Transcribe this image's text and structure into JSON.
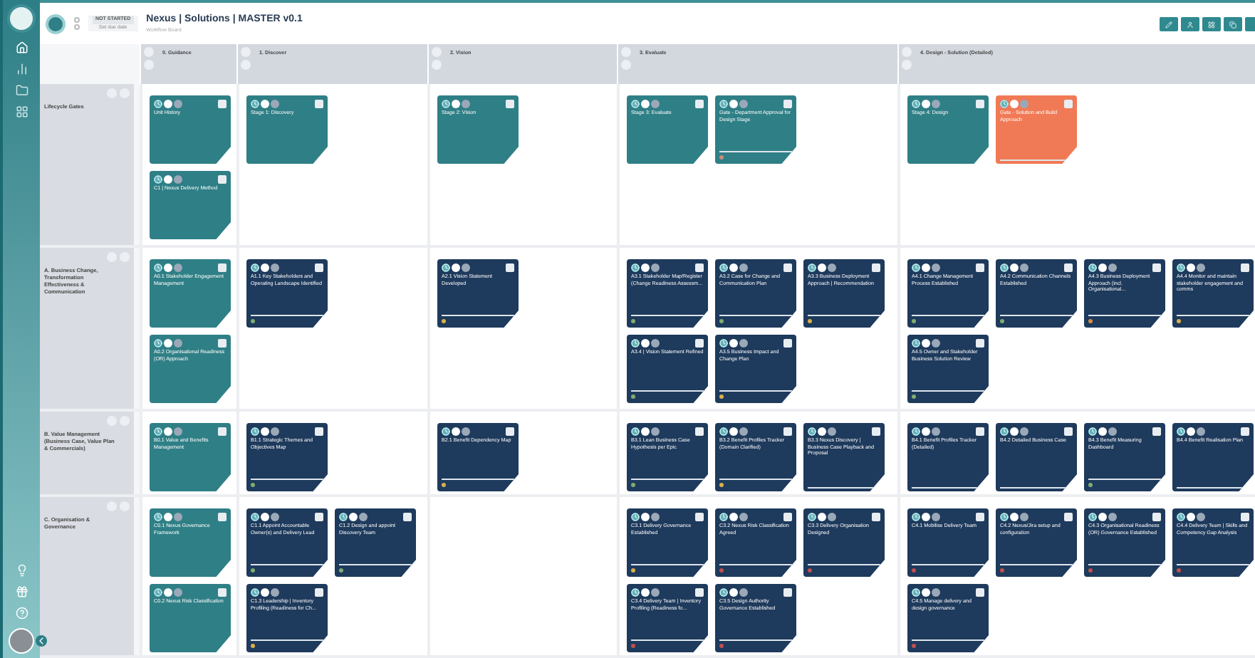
{
  "header": {
    "status": "NOT STARTED",
    "due": "Set due date",
    "title": "Nexus | Solutions | MASTER v0.1",
    "subtitle": "Workflow Board"
  },
  "columns": [
    {
      "title": "0. Guidance"
    },
    {
      "title": "1. Discover"
    },
    {
      "title": "2. Vision"
    },
    {
      "title": "3. Evaluate"
    },
    {
      "title": "4. Design - Solution (Detailed)"
    }
  ],
  "rows": [
    {
      "title": "Lifecycle Gates",
      "cells": [
        [
          {
            "name": "Unit History",
            "color": "#2f7f86",
            "bar": false
          },
          {
            "name": "C1 | Nexus Delivery Method",
            "color": "#2f7f86",
            "bar": false
          }
        ],
        [
          {
            "name": "Stage 1: Discovery",
            "color": "#2f7f86",
            "bar": false
          }
        ],
        [
          {
            "name": "Stage 2: Vision",
            "color": "#2f7f86",
            "bar": false
          }
        ],
        [
          {
            "name": "Stage 3: Evaluate",
            "color": "#2f7f86",
            "bar": false
          },
          {
            "name": "Gate - Department Approval for Design Stage",
            "color": "#2f7f86",
            "bar": true,
            "status": {
              "color": "#c98a7a"
            }
          }
        ],
        [
          {
            "name": "Stage 4: Design",
            "color": "#2f7f86",
            "bar": false
          },
          {
            "name": "Gate - Solution and Build Approach",
            "color": "#f07a55",
            "bar": true
          }
        ]
      ]
    },
    {
      "title": "A. Business Change, Transformation Effectiveness & Communication",
      "cells": [
        [
          {
            "name": "A0.1 Stakeholder Engagement Management",
            "color": "#2f7f86",
            "bar": false
          },
          {
            "name": "A0.2 Organisational Readiness (OR) Approach",
            "color": "#2f7f86",
            "bar": false
          }
        ],
        [
          {
            "name": "A1.1 Key Stakeholders and Operating Landscape Identified",
            "color": "#1e3a5c",
            "bar": true,
            "status": {
              "color": "#7fae6f"
            }
          }
        ],
        [
          {
            "name": "A2.1 Vision Statement Developed",
            "color": "#1e3a5c",
            "bar": true,
            "status": {
              "color": "#d9b04a"
            }
          }
        ],
        [
          {
            "name": "A3.1 Stakeholder Map/Register (Change Readiness Assessm...",
            "color": "#1e3a5c",
            "bar": true,
            "status": {
              "color": "#7fae6f"
            }
          },
          {
            "name": "A3.2 Case for Change and Communication Plan",
            "color": "#1e3a5c",
            "bar": true,
            "status": {
              "color": "#7fae6f"
            }
          },
          {
            "name": "A3.3 Business Deployment Approach | Recommendation",
            "color": "#1e3a5c",
            "bar": true,
            "status": {
              "color": "#d9b04a"
            }
          },
          {
            "name": "A3.4 | Vision Statement Refined",
            "color": "#1e3a5c",
            "bar": true,
            "status": {
              "color": "#7fae6f"
            }
          },
          {
            "name": "A3.5 Business Impact and Change Plan",
            "color": "#1e3a5c",
            "bar": true,
            "status": {
              "color": "#d9b04a"
            }
          }
        ],
        [
          {
            "name": "A4.1 Change Management Process Established",
            "color": "#1e3a5c",
            "bar": true,
            "status": {
              "color": "#7fae6f"
            }
          },
          {
            "name": "A4.2 Communication Channels Established",
            "color": "#1e3a5c",
            "bar": true,
            "status": {
              "color": "#7fae6f"
            }
          },
          {
            "name": "A4.3 Business Deployment Approach (incl. Organisational...",
            "color": "#1e3a5c",
            "bar": true,
            "status": {
              "color": "#e08a3a"
            }
          },
          {
            "name": "A4.4 Monitor and maintain stakeholder engagement and comms",
            "color": "#1e3a5c",
            "bar": true,
            "status": {
              "color": "#d9b04a"
            }
          },
          {
            "name": "A4.5 Owner and Stakeholder Business Solution Review",
            "color": "#1e3a5c",
            "bar": true,
            "status": {
              "color": "#7fae6f"
            }
          }
        ]
      ]
    },
    {
      "title": "B. Value Management (Business Case, Value Plan & Commercials)",
      "cells": [
        [
          {
            "name": "B0.1 Value and Benefits Management",
            "color": "#2f7f86",
            "bar": false
          }
        ],
        [
          {
            "name": "B1.1 Strategic Themes and Objectives Map",
            "color": "#1e3a5c",
            "bar": true,
            "status": {
              "color": "#7fae6f"
            }
          }
        ],
        [
          {
            "name": "B2.1 Benefit Dependency Map",
            "color": "#1e3a5c",
            "bar": true,
            "status": {
              "color": "#d9b04a"
            }
          }
        ],
        [
          {
            "name": "B3.1 Lean Business Case Hypothesis per Epic",
            "color": "#1e3a5c",
            "bar": true,
            "status": {
              "color": "#7fae6f"
            }
          },
          {
            "name": "B3.2 Benefit Profiles Tracker (Domain Clarified)",
            "color": "#1e3a5c",
            "bar": true,
            "status": {
              "color": "#d9b04a"
            }
          },
          {
            "name": "B3.3 Nexus Discovery | Business Case Playback and Proposal",
            "color": "#1e3a5c",
            "bar": true
          }
        ],
        [
          {
            "name": "B4.1 Benefit Profiles Tracker (Detailed)",
            "color": "#1e3a5c",
            "bar": true
          },
          {
            "name": "B4.2 Detailed Business Case",
            "color": "#1e3a5c",
            "bar": true
          },
          {
            "name": "B4.3 Benefit Measuring Dashboard",
            "color": "#1e3a5c",
            "bar": true,
            "status": {
              "color": "#7fae6f"
            }
          },
          {
            "name": "B4.4 Benefit Realisation Plan",
            "color": "#1e3a5c",
            "bar": true
          }
        ]
      ]
    },
    {
      "title": "C. Organisation & Governance",
      "cells": [
        [
          {
            "name": "C0.1 Nexus Governance Framework",
            "color": "#2f7f86",
            "bar": false
          },
          {
            "name": "C0.2 Nexus Risk Classification",
            "color": "#2f7f86",
            "bar": false
          }
        ],
        [
          {
            "name": "C1.1 Appoint Accountable Owner(s) and Delivery Lead",
            "color": "#1e3a5c",
            "bar": true,
            "status": {
              "color": "#7fae6f"
            }
          },
          {
            "name": "C1.2 Design and appoint Discovery Team",
            "color": "#1e3a5c",
            "bar": true,
            "status": {
              "color": "#7fae6f"
            }
          },
          {
            "name": "C1.3 Leadership | Inventory Profiling (Readiness for Ch...",
            "color": "#1e3a5c",
            "bar": true,
            "status": {
              "color": "#d9b04a"
            }
          }
        ],
        [],
        [
          {
            "name": "C3.1 Delivery Governance Established",
            "color": "#1e3a5c",
            "bar": true,
            "status": {
              "color": "#d9b04a"
            }
          },
          {
            "name": "C3.2 Nexus Risk Classification Agreed",
            "color": "#1e3a5c",
            "bar": true,
            "status": {
              "color": "#c0504d"
            }
          },
          {
            "name": "C3.3 Delivery Organisation Designed",
            "color": "#1e3a5c",
            "bar": true,
            "status": {
              "color": "#c0504d"
            }
          },
          {
            "name": "C3.4 Delivery Team | Inventory Profiling (Readiness fo...",
            "color": "#1e3a5c",
            "bar": true,
            "status": {
              "color": "#c0504d"
            }
          },
          {
            "name": "C3.5 Design Authority Governance Established",
            "color": "#1e3a5c",
            "bar": true,
            "status": {
              "color": "#c0504d"
            }
          }
        ],
        [
          {
            "name": "C4.1 Mobilise Delivery Team",
            "color": "#1e3a5c",
            "bar": true,
            "status": {
              "color": "#c0504d"
            }
          },
          {
            "name": "C4.2 Nexus/Jira setup and configuration",
            "color": "#1e3a5c",
            "bar": true,
            "status": {
              "color": "#c0504d"
            }
          },
          {
            "name": "C4.3 Organisational Readiness (OR) Governance Established",
            "color": "#1e3a5c",
            "bar": true,
            "status": {
              "color": "#c0504d"
            }
          },
          {
            "name": "C4.4 Delivery Team | Skills and Competency Gap Analysis",
            "color": "#1e3a5c",
            "bar": true,
            "status": {
              "color": "#c0504d"
            }
          },
          {
            "name": "C4.5 Manage delivery and design governance",
            "color": "#1e3a5c",
            "bar": true,
            "status": {
              "color": "#c0504d"
            }
          }
        ]
      ]
    }
  ]
}
